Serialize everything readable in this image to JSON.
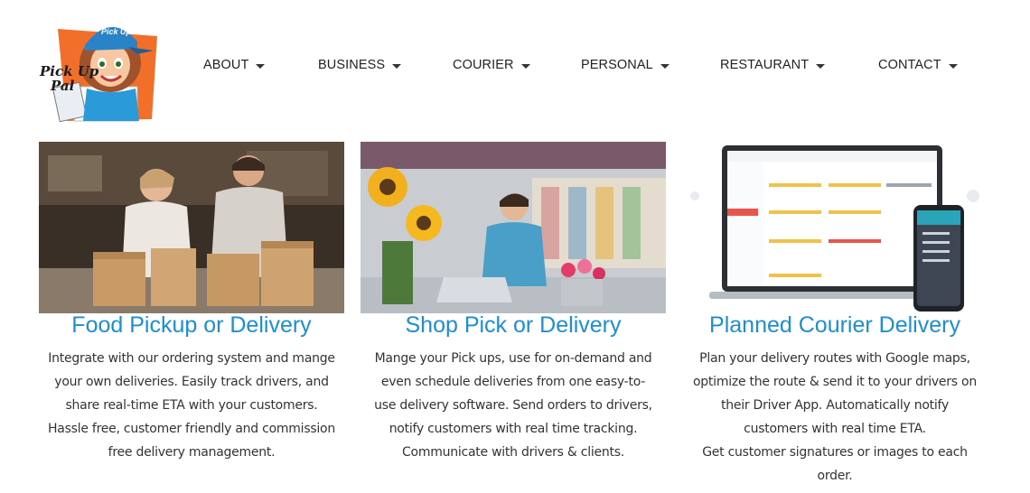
{
  "logo": {
    "text_line1": "Pick Up",
    "text_line2": "Pal",
    "badge": "Pick Up Pal"
  },
  "nav": {
    "items": [
      {
        "label": "ABOUT"
      },
      {
        "label": "BUSINESS"
      },
      {
        "label": "COURIER"
      },
      {
        "label": "PERSONAL"
      },
      {
        "label": "RESTAURANT"
      },
      {
        "label": "CONTACT"
      }
    ]
  },
  "cards": [
    {
      "title": "Food Pickup or  Delivery",
      "image": "restaurant-staff-with-paper-bags",
      "lines": [
        "Integrate with our ordering system and mange",
        "your own deliveries. Easily track drivers, and",
        "share real-time ETA with your customers.",
        "Hassle free, customer friendly and commission",
        "free delivery management."
      ]
    },
    {
      "title": "Shop Pick or Delivery",
      "image": "florist-on-phone-with-laptop",
      "lines": [
        "Mange your Pick ups, use for on-demand and",
        "even schedule deliveries from one easy-to-",
        "use delivery software. Send orders to drivers,",
        "notify customers with real time tracking.",
        "Communicate with drivers & clients."
      ]
    },
    {
      "title": "Planned Courier Delivery",
      "image": "laptop-and-phone-dashboard",
      "lines": [
        "Plan your delivery routes with Google maps,",
        "optimize the route & send it to your drivers on",
        "their Driver App. Automatically notify",
        "customers with real time ETA.",
        "Get customer signatures or images to each",
        "order."
      ]
    }
  ],
  "colors": {
    "title_blue": "#1c8fd1",
    "logo_orange": "#f26f2a",
    "cap_blue": "#2a83c7"
  }
}
